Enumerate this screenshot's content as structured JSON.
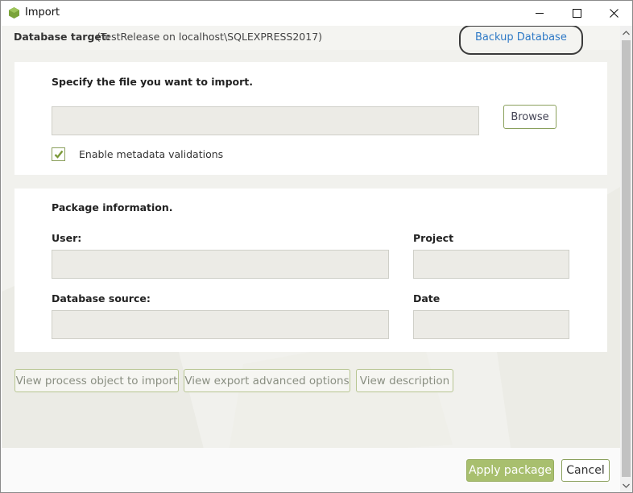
{
  "window": {
    "title": "Import",
    "controls": {
      "minimize": "minimize-icon",
      "maximize": "maximize-icon",
      "close": "close-icon"
    }
  },
  "target": {
    "label": "Database target:",
    "value": "(TestRelease on localhost\\SQLEXPRESS2017)",
    "backup_link": "Backup Database"
  },
  "file_section": {
    "heading": "Specify the file you want to import.",
    "file_value": "",
    "browse_label": "Browse",
    "metadata_checkbox": {
      "label": "Enable metadata validations",
      "checked": true
    }
  },
  "package_section": {
    "heading": "Package information.",
    "user_label": "User:",
    "user_value": "",
    "project_label": "Project",
    "project_value": "",
    "db_source_label": "Database source:",
    "db_source_value": "",
    "date_label": "Date",
    "date_value": ""
  },
  "actions": {
    "view_process": "View process object to import",
    "view_export": "View export advanced options",
    "view_description": "View description"
  },
  "footer": {
    "apply": "Apply package",
    "cancel": "Cancel"
  },
  "colors": {
    "accent_green": "#a8bf6e",
    "border_green": "#8aa05c",
    "link_blue": "#2e79c6"
  }
}
